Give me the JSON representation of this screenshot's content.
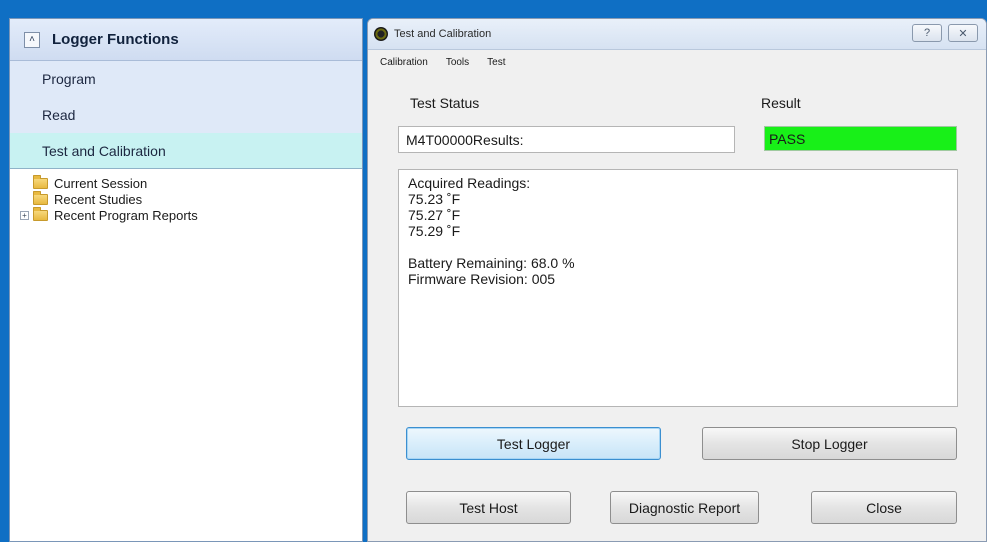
{
  "left_panel": {
    "title": "Logger Functions",
    "collapse_glyph": "˄",
    "items": [
      {
        "label": "Program"
      },
      {
        "label": "Read"
      },
      {
        "label": "Test and Calibration"
      }
    ],
    "tree": [
      {
        "label": "Current Session",
        "expander": ""
      },
      {
        "label": "Recent Studies",
        "expander": ""
      },
      {
        "label": "Recent Program Reports",
        "expander": "+"
      }
    ]
  },
  "dialog": {
    "title": "Test and Calibration",
    "help_glyph": "?",
    "close_glyph": "✕",
    "menu": [
      "Calibration",
      "Tools",
      "Test"
    ],
    "test_status_label": "Test Status",
    "result_label": "Result",
    "status_value": "M4T00000Results:",
    "result_value": "PASS",
    "readings_lines": [
      "Acquired Readings:",
      "75.23 ˚F",
      "75.27 ˚F",
      "75.29 ˚F",
      "",
      "Battery Remaining: 68.0 %",
      "Firmware Revision: 005"
    ],
    "buttons": {
      "test_logger": "Test Logger",
      "stop_logger": "Stop Logger",
      "test_host": "Test Host",
      "diagnostic_report": "Diagnostic Report",
      "close": "Close"
    }
  },
  "colors": {
    "desktop_blue": "#0f6fc4",
    "pass_green": "#18f018",
    "active_item": "#c8f2f2"
  }
}
